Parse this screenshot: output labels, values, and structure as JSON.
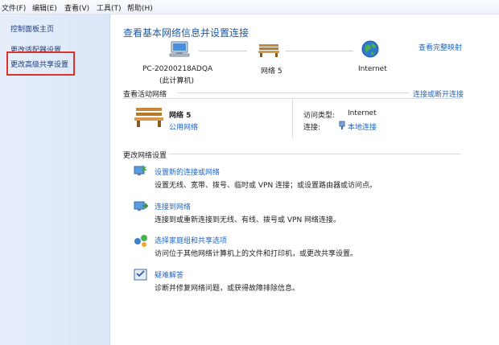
{
  "menubar": {
    "items": [
      "文件(F)",
      "编辑(E)",
      "查看(V)",
      "工具(T)",
      "帮助(H)"
    ]
  },
  "sidebar": {
    "items": [
      {
        "label": "控制面板主页"
      },
      {
        "label": "更改适配器设置"
      },
      {
        "label": "更改高级共享设置"
      }
    ],
    "highlight_color": "#e0302a"
  },
  "main": {
    "title": "查看基本网络信息并设置连接",
    "view_full_map": "查看完整映射",
    "map": {
      "computer_name": "PC-20200218ADQA",
      "computer_sub": "(此计算机)",
      "network_name": "网络  5",
      "internet": "Internet"
    },
    "active": {
      "section_label": "查看活动网络",
      "connect_disconnect": "连接或断开连接",
      "network_name": "网络  5",
      "network_type": "公用网络",
      "access_type_label": "访问类型:",
      "access_type_value": "Internet",
      "connection_label": "连接:",
      "connection_value": "本地连接"
    },
    "settings": {
      "section_label": "更改网络设置",
      "tasks": [
        {
          "title": "设置新的连接或网络",
          "desc": "设置无线、宽带、拨号、临时或 VPN 连接；或设置路由器或访问点。",
          "icon": "new-connection-icon"
        },
        {
          "title": "连接到网络",
          "desc": "连接到或重新连接到无线、有线、拨号或 VPN 网络连接。",
          "icon": "connect-network-icon"
        },
        {
          "title": "选择家庭组和共享选项",
          "desc": "访问位于其他网络计算机上的文件和打印机，或更改共享设置。",
          "icon": "homegroup-icon"
        },
        {
          "title": "疑难解答",
          "desc": "诊断并修复网络问题，或获得故障排除信息。",
          "icon": "troubleshoot-icon"
        }
      ]
    }
  },
  "colors": {
    "link": "#1f66c8",
    "title": "#1d5aa7",
    "sidebar_bg": "#dbe7f7"
  }
}
